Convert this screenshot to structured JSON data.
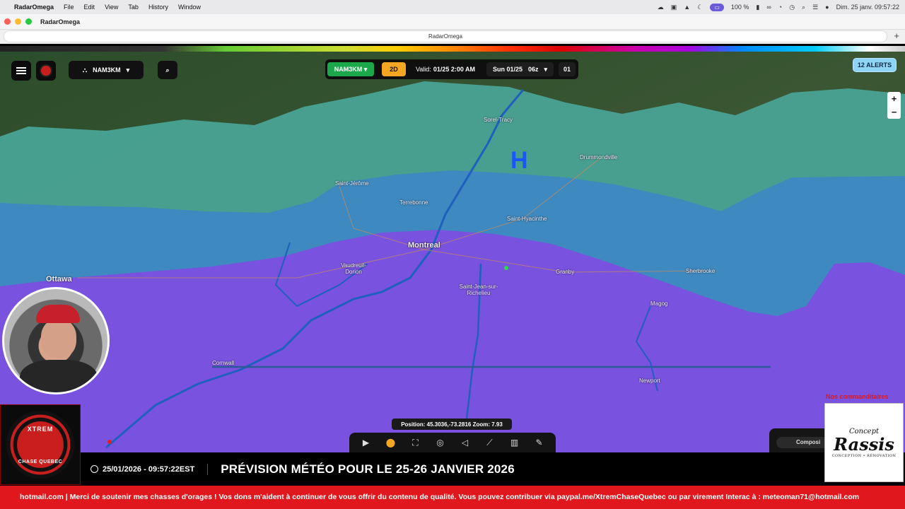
{
  "menubar": {
    "app": "RadarOmega",
    "items": [
      "File",
      "Edit",
      "View",
      "Tab",
      "History",
      "Window"
    ],
    "battery": "100 %",
    "datetime": "Dim. 25 janv. 09:57:22"
  },
  "window": {
    "title": "RadarOmega",
    "url": "RadarOmega"
  },
  "map": {
    "cities": [
      "Sorel-Tracy",
      "Drummondville",
      "Saint-Jérôme",
      "Terrebonne",
      "Saint-Hyacinthe",
      "Montreal",
      "Vaudreuil-Dorion",
      "Ottawa",
      "Saint-Jean-sur-Richelieu",
      "Granby",
      "Sherbrooke",
      "Magog",
      "Cornwall",
      "Newport"
    ],
    "pressure_marker": "H",
    "colors": {
      "band_teal": "#4aa79a",
      "band_blue": "#3d86c4",
      "band_purple": "#7c4fe0",
      "land": "#2e4a2a"
    }
  },
  "controls": {
    "model_selector": "NAM3KM",
    "model_chip": "NAM3KM",
    "view_mode": "2D",
    "valid_label": "Valid:",
    "valid_value": "01/25 2:00 AM",
    "run_day": "Sun 01/25",
    "run_hour": "06z",
    "step": "01",
    "alerts": "12 ALERTS",
    "zoom_in": "+",
    "zoom_out": "−",
    "position": "Position: 45.3036,-73.2816 Zoom: 7.93",
    "composite": "Composi"
  },
  "stream": {
    "logo_top": "XTREM",
    "logo_bottom": "CHASE QUEBEC",
    "sponsor_label": "Nos commanditaires",
    "sponsor_line1": "Concept",
    "sponsor_line2": "Rassis",
    "sponsor_line3": "CONCEPTION • RÉNOVATION",
    "timestamp": "25/01/2026 - 09:57:22EST",
    "headline": "PRÉVISION MÉTÉO POUR LE 25-26 JANVIER 2026",
    "ticker": "hotmail.com | Merci de soutenir mes chasses d'orages ! Vos dons m'aident à continuer de vous offrir du contenu de qualité. Vous pouvez contribuer via paypal.me/XtremChaseQuebec ou par virement Interac à : meteoman71@hotmail.com"
  }
}
